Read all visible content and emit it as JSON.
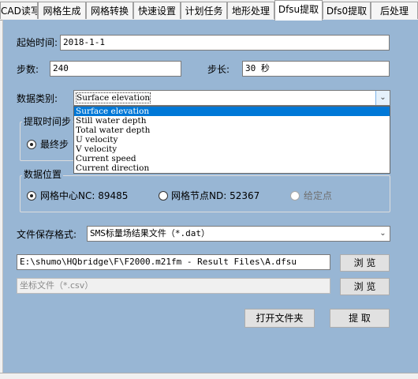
{
  "tabs": [
    "CAD读写",
    "网格生成",
    "网格转换",
    "快速设置",
    "计划任务",
    "地形处理",
    "Dfsu提取",
    "Dfs0提取",
    "后处理"
  ],
  "active_tab": "Dfsu提取",
  "form": {
    "start_time_label": "起始时间:",
    "start_time_value": "2018-1-1",
    "steps_label": "步数:",
    "steps_value": "240",
    "step_size_label": "步长:",
    "step_size_value": "30 秒",
    "data_type_label": "数据类别:",
    "data_type_selected": "Surface elevation",
    "data_type_options": [
      "Surface elevation",
      "Still water depth",
      "Total water depth",
      "U velocity",
      "V velocity",
      "Current speed",
      "Current direction"
    ],
    "extract_step_group_title": "提取时间步",
    "final_step_label": "最终步",
    "data_position_title": "数据位置",
    "mesh_center_label": "网格中心NC: 89485",
    "mesh_node_label": "网格节点ND: 52367",
    "given_point_label": "给定点",
    "file_format_label": "文件保存格式:",
    "file_format_value": "SMS标量场结果文件（*.dat）",
    "file_path_value": "E:\\shumo\\HQbridge\\F\\F2000.m21fm - Result Files\\A.dfsu",
    "browse_label": "浏 览",
    "coord_file_placeholder": "坐标文件（*.csv）",
    "browse2_label": "浏 览",
    "open_folder_label": "打开文件夹",
    "extract_label": "提 取"
  },
  "colors": {
    "panel_bg": "#98b6d4",
    "selection": "#0078d7"
  }
}
